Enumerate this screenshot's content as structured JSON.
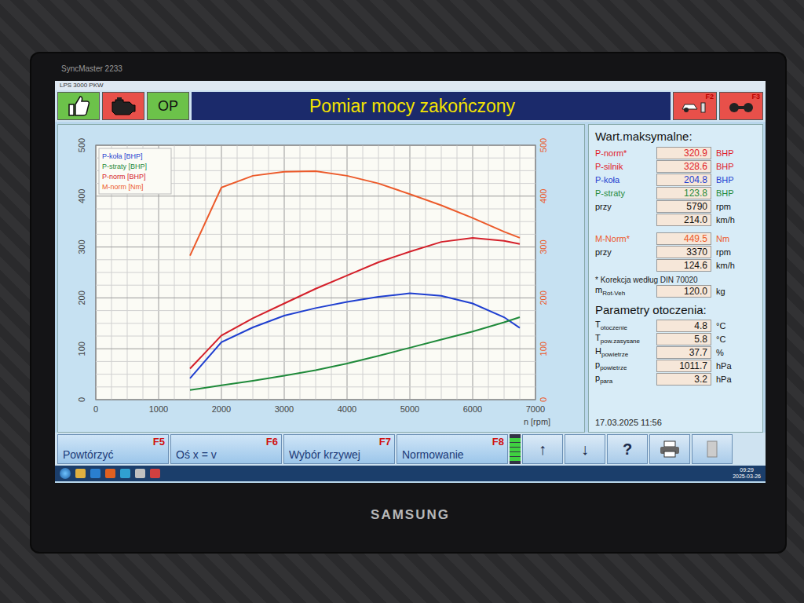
{
  "monitor": {
    "model": "SyncMaster 2233",
    "brand": "SAMSUNG"
  },
  "window": {
    "title": "LPS 3000 PKW"
  },
  "header": {
    "title": "Pomiar mocy zakończony",
    "badge": "OP",
    "right_keys": [
      "F2",
      "F3"
    ]
  },
  "chart": {
    "legend": [
      {
        "label": "P-koła [BHP]",
        "color": "#1f3fd0"
      },
      {
        "label": "P-straty [BHP]",
        "color": "#1f8a3a"
      },
      {
        "label": "P-norm [BHP]",
        "color": "#d4202a"
      },
      {
        "label": "M-norm [Nm]",
        "color": "#ec5a2a"
      }
    ],
    "x_ticks": [
      "0",
      "1000",
      "2000",
      "3000",
      "4000",
      "5000",
      "6000",
      "7000"
    ],
    "x_label": "n [rpm]",
    "y_ticks": [
      "0",
      "100",
      "200",
      "300",
      "400",
      "500"
    ],
    "y2_ticks": [
      "0",
      "100",
      "200",
      "300",
      "400",
      "500"
    ],
    "rpm": [
      1500,
      2000,
      2500,
      3000,
      3500,
      4000,
      4500,
      5000,
      5500,
      6000,
      6500,
      6750
    ],
    "series": [
      {
        "name": "P-koła",
        "color": "#1f3fd0",
        "values": [
          42,
          113,
          142,
          165,
          180,
          192,
          202,
          209,
          204,
          189,
          162,
          141
        ]
      },
      {
        "name": "P-straty",
        "color": "#1f8a3a",
        "values": [
          19,
          28,
          37,
          47,
          58,
          71,
          86,
          102,
          118,
          134,
          152,
          162
        ]
      },
      {
        "name": "P-norm",
        "color": "#d4202a",
        "values": [
          61,
          126,
          160,
          189,
          218,
          244,
          270,
          291,
          310,
          318,
          312,
          306
        ]
      },
      {
        "name": "M-norm",
        "color": "#ec5a2a",
        "values": [
          283,
          417,
          440,
          448,
          449,
          440,
          425,
          404,
          382,
          357,
          330,
          318
        ]
      }
    ]
  },
  "max_panel": {
    "title": "Wart.maksymalne:",
    "rows": [
      {
        "label": "P-norm*",
        "value": "320.9",
        "unit": "BHP",
        "color": "#e0202a"
      },
      {
        "label": "P-silnik",
        "value": "328.6",
        "unit": "BHP",
        "color": "#e0202a"
      },
      {
        "label": "P-koła",
        "value": "204.8",
        "unit": "BHP",
        "color": "#1f3fd0"
      },
      {
        "label": "P-straty",
        "value": "123.8",
        "unit": "BHP",
        "color": "#1f8a3a"
      },
      {
        "label": "przy",
        "value": "5790",
        "unit": "rpm",
        "color": "#111111"
      },
      {
        "label": "",
        "value": "214.0",
        "unit": "km/h",
        "color": "#111111"
      }
    ],
    "torque_rows": [
      {
        "label": "M-Norm*",
        "value": "449.5",
        "unit": "Nm",
        "color": "#ec5a2a"
      },
      {
        "label": "przy",
        "value": "3370",
        "unit": "rpm",
        "color": "#111111"
      },
      {
        "label": "",
        "value": "124.6",
        "unit": "km/h",
        "color": "#111111"
      }
    ],
    "note": "* Korekcja według DIN 70020",
    "mass": {
      "symbol": "m",
      "sub": "Rot-Veh",
      "value": "120.0",
      "unit": "kg"
    },
    "ambient_title": "Parametry otoczenia:",
    "ambient": [
      {
        "symbol": "T",
        "sub": "otoczenie",
        "value": "4.8",
        "unit": "°C"
      },
      {
        "symbol": "T",
        "sub": "pow.zasysane",
        "value": "5.8",
        "unit": "°C"
      },
      {
        "symbol": "H",
        "sub": "powietrze",
        "value": "37.7",
        "unit": "%"
      },
      {
        "symbol": "p",
        "sub": "powietrze",
        "value": "1011.7",
        "unit": "hPa"
      },
      {
        "symbol": "p",
        "sub": "para",
        "value": "3.2",
        "unit": "hPa"
      }
    ],
    "timestamp": "17.03.2025  11:56"
  },
  "buttons": [
    {
      "key": "F5",
      "label": "Powtórzyć"
    },
    {
      "key": "F6",
      "label": "Oś x = v"
    },
    {
      "key": "F7",
      "label": "Wybór krzywej"
    },
    {
      "key": "F8",
      "label": "Normowanie"
    }
  ],
  "tool_buttons": [
    "↑",
    "↓",
    "?"
  ],
  "taskbar": {
    "time": "09:29",
    "date": "2025-03-26"
  }
}
